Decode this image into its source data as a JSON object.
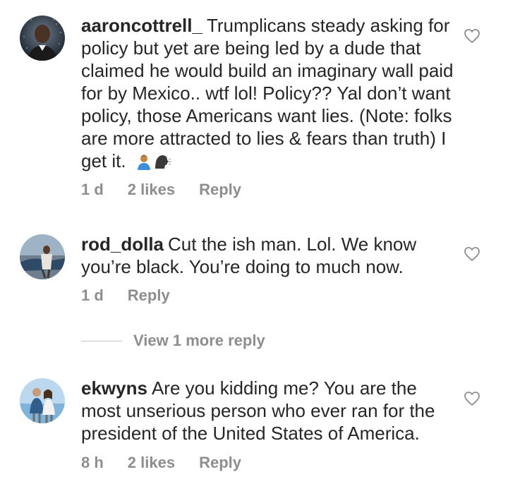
{
  "comments": [
    {
      "username": "aaroncottrell_",
      "text": "Trumplicans steady asking for policy but yet are being led by a dude that claimed he would build an imaginary wall paid for by Mexico.. wtf lol! Policy?? Yal don’t want policy, those Americans want lies. (Note: folks are more attracted to lies & fears than truth) I get it.",
      "time": "1 d",
      "likes": "2 likes",
      "reply": "Reply"
    },
    {
      "username": "rod_dolla",
      "text": "Cut the ish man. Lol. We know you’re black. You’re doing to much now.",
      "time": "1 d",
      "reply": "Reply"
    },
    {
      "username": "ekwyns",
      "text": "Are you kidding me?  You are the most unserious person who ever ran for the president of the United States of America.",
      "time": "8 h",
      "likes": "2 likes",
      "reply": "Reply"
    }
  ],
  "view_more_replies": "View 1 more reply",
  "icons": {
    "like": "heart-outline-icon",
    "emoji_1": "person-shrugging-emoji-icon",
    "emoji_2": "speaking-head-emoji-icon"
  },
  "colors": {
    "text": "#262626",
    "meta": "#8e8e8e",
    "heart": "#8e8e8e"
  }
}
